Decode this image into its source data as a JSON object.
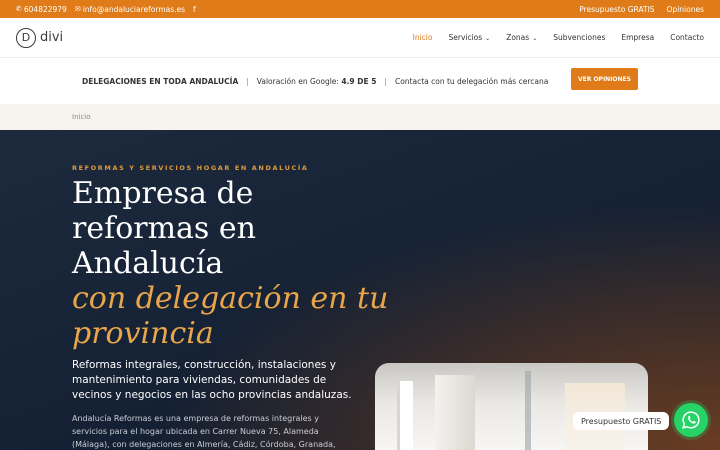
{
  "topbar": {
    "phone": "604822979",
    "email": "info@andaluciareformas.es",
    "facebook_icon": "f",
    "links": [
      "Presupuesto GRATIS",
      "Opiniones"
    ]
  },
  "nav": {
    "logo_mark": "D",
    "logo_text": "divi",
    "items": [
      {
        "label": "Inicio"
      },
      {
        "label": "Servicios"
      },
      {
        "label": "Zonas"
      },
      {
        "label": "Subvenciones"
      },
      {
        "label": "Empresa"
      },
      {
        "label": "Contacto"
      }
    ]
  },
  "banner": {
    "delegations": "DELEGACIONES EN TODA ANDALUCÍA",
    "rating_prefix": "Valoración en Google: ",
    "rating_value": "4.9 DE 5",
    "contact": "Contacta con tu delegación más cercana",
    "button": "VER OPINIONES"
  },
  "breadcrumb": "Inicio",
  "hero": {
    "eyebrow": "REFORMAS Y SERVICIOS HOGAR EN ANDALUCÍA",
    "title": "Empresa de reformas en Andalucía",
    "title_italic": "con delegación en tu provincia",
    "lead": "Reformas integrales, construcción, instalaciones y mantenimiento para viviendas, comunidades de vecinos y negocios en las ocho provincias andaluzas.",
    "body": "Andalucía Reformas es una empresa de reformas integrales y servicios para el hogar ubicada en Carrer Nueva 75, Alameda (Málaga), con delegaciones en Almería, Cádiz, Córdoba, Granada, Huelva, Jaén,"
  },
  "whatsapp": {
    "label": "Presupuesto GRATIS"
  },
  "colors": {
    "accent": "#e07b1a",
    "hero_bg": "#1d2a3d",
    "italic_title": "#e9a54a",
    "whatsapp": "#25d366"
  }
}
